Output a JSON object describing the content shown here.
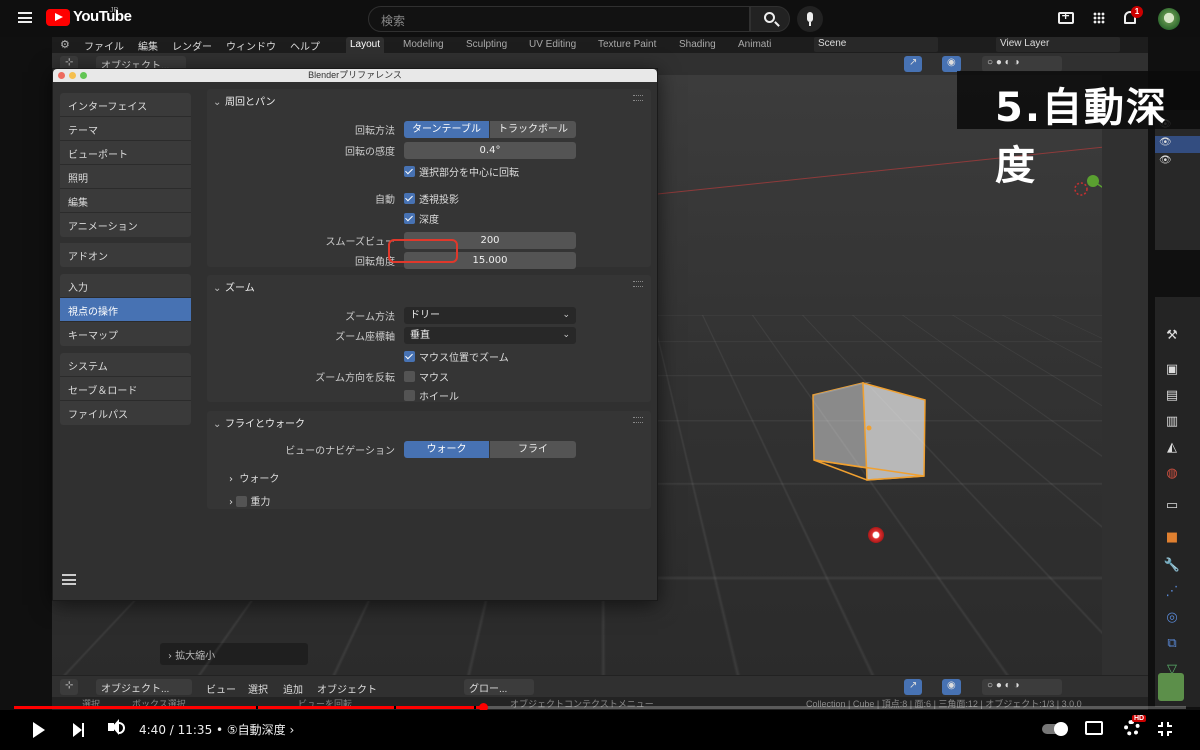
{
  "youtube": {
    "logo_text": "YouTube",
    "region": "JP",
    "search_placeholder": "検索",
    "notification_count": "1"
  },
  "blender": {
    "menus": [
      "ファイル",
      "編集",
      "レンダー",
      "ウィンドウ",
      "ヘルプ"
    ],
    "workspaces": [
      "Layout",
      "Modeling",
      "Sculpting",
      "UV Editing",
      "Texture Paint",
      "Shading",
      "Animati"
    ],
    "active_workspace": "Layout",
    "scene": "Scene",
    "view_layer": "View Layer",
    "header": {
      "mode": "オブジェクト...",
      "view": "ビュー",
      "select": "選択",
      "add": "追加",
      "object": "オブジェクト",
      "orientation": "グロー..."
    },
    "zoom_panel": "拡大縮小",
    "status": {
      "select": "選択",
      "box_select": "ボックス選択",
      "rotate_view": "ビューを回転",
      "context_menu": "オブジェクトコンテクストメニュー",
      "stats": "Collection | Cube | 頂点:8 | 面:6 | 三角面:12 | オブジェクト:1/3 | 3.0.0"
    }
  },
  "title_card": "5.自動深度",
  "preferences": {
    "window_title": "Blenderプリファレンス",
    "nav_groups": [
      [
        "インターフェイス",
        "テーマ",
        "ビューポート",
        "照明",
        "編集",
        "アニメーション"
      ],
      [
        "アドオン"
      ],
      [
        "入力",
        "視点の操作",
        "キーマップ"
      ],
      [
        "システム",
        "セーブ＆ロード",
        "ファイルパス"
      ]
    ],
    "active_nav": "視点の操作",
    "orbit_pan": {
      "title": "周回とパン",
      "orbit_method_label": "回転方法",
      "orbit_methods": [
        "ターンテーブル",
        "トラックボール"
      ],
      "orbit_method_selected": "ターンテーブル",
      "sensitivity_label": "回転の感度",
      "sensitivity": "0.4°",
      "orbit_selection": {
        "label": "選択部分を中心に回転",
        "checked": true
      },
      "auto_label": "自動",
      "auto_perspective": {
        "label": "透視投影",
        "checked": true
      },
      "auto_depth": {
        "label": "深度",
        "checked": true
      },
      "smooth_view_label": "スムーズビュー",
      "smooth_view": "200",
      "rotation_angle_label": "回転角度",
      "rotation_angle": "15.000"
    },
    "zoom": {
      "title": "ズーム",
      "method_label": "ズーム方法",
      "method": "ドリー",
      "axis_label": "ズーム座標軸",
      "axis": "垂直",
      "to_mouse": {
        "label": "マウス位置でズーム",
        "checked": true
      },
      "invert_label": "ズーム方向を反転",
      "invert_mouse": {
        "label": "マウス",
        "checked": false
      },
      "invert_wheel": {
        "label": "ホイール",
        "checked": false
      }
    },
    "fly_walk": {
      "title": "フライとウォーク",
      "nav_label": "ビューのナビゲーション",
      "options": [
        "ウォーク",
        "フライ"
      ],
      "selected": "ウォーク",
      "walk_sub": "ウォーク",
      "gravity_sub": "重力"
    }
  },
  "player": {
    "progress": 0.4,
    "time": "4:40 / 11:35",
    "chapter": "• ⑤自動深度 ›",
    "hd_badge": "HD"
  },
  "colors": {
    "accent": "#4772b3",
    "highlight_ring": "#e0382b",
    "youtube_red": "#ff0000"
  }
}
